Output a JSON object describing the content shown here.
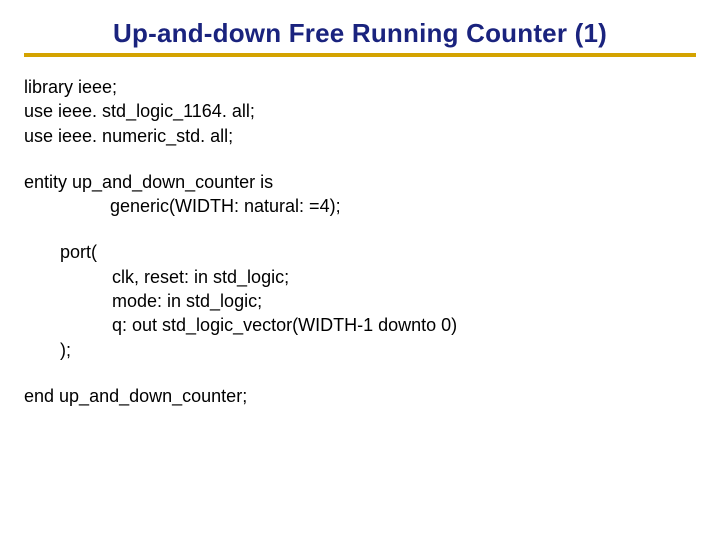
{
  "title": "Up-and-down Free Running Counter (1)",
  "code": {
    "l1": "library ieee;",
    "l2": "use ieee. std_logic_1164. all;",
    "l3": "use ieee. numeric_std. all;",
    "l4": "entity up_and_down_counter is",
    "l5": "generic(WIDTH: natural: =4);",
    "l6": "port(",
    "l7": "clk, reset: in std_logic;",
    "l8": "mode: in std_logic;",
    "l9": "q: out std_logic_vector(WIDTH-1 downto 0)",
    "l10": ");",
    "l11": "end up_and_down_counter;"
  }
}
